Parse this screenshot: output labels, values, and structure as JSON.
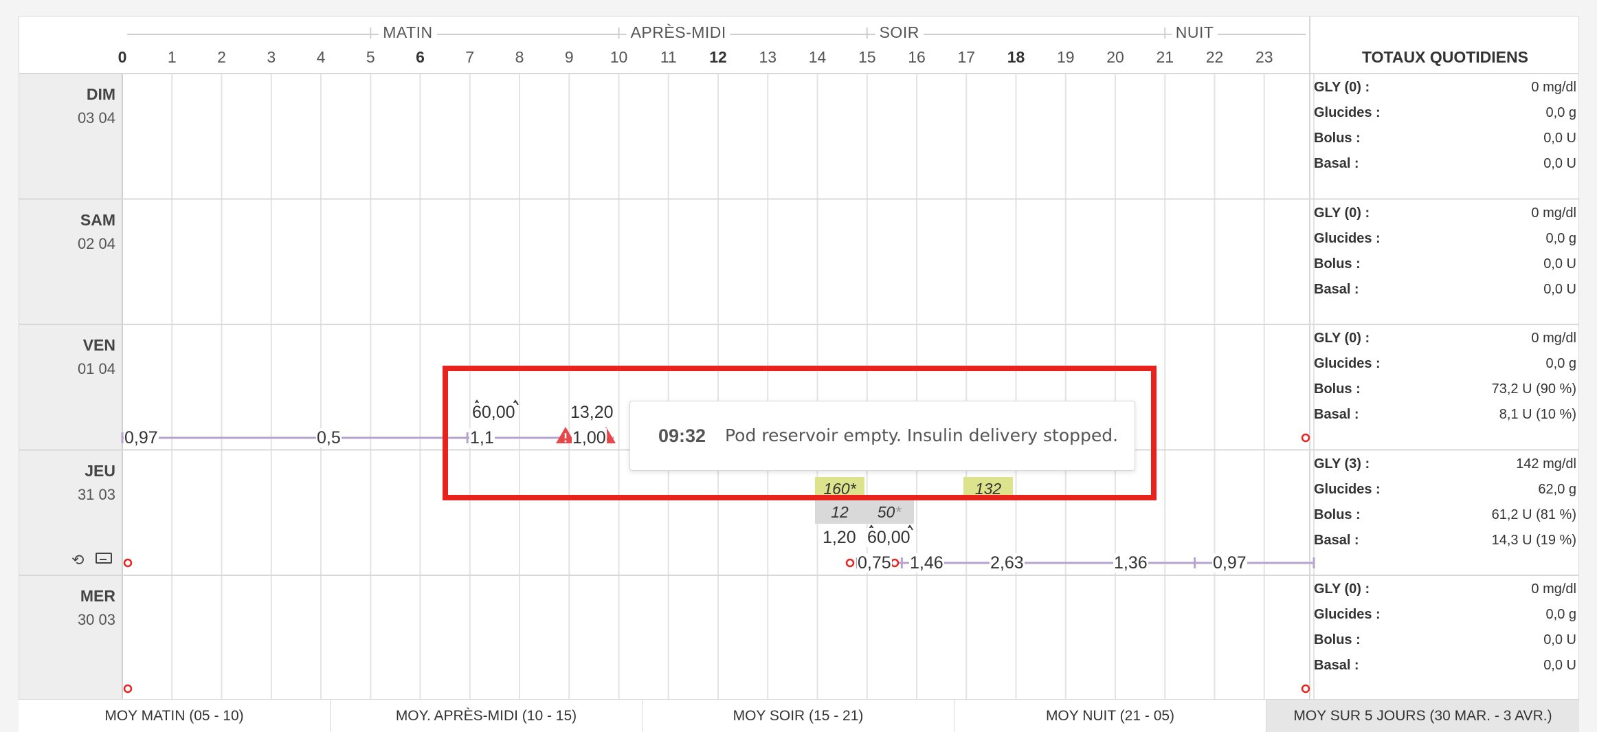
{
  "periods": [
    {
      "label": "MATIN",
      "hour": 5.75
    },
    {
      "label": "APRÈS-MIDI",
      "hour": 11.2
    },
    {
      "label": "SOIR",
      "hour": 15.65
    },
    {
      "label": "NUIT",
      "hour": 21.6
    }
  ],
  "hours": [
    "0",
    "1",
    "2",
    "3",
    "4",
    "5",
    "6",
    "7",
    "8",
    "9",
    "10",
    "11",
    "12",
    "13",
    "14",
    "15",
    "16",
    "17",
    "18",
    "19",
    "20",
    "21",
    "22",
    "23"
  ],
  "bold_hours": [
    "0",
    "6",
    "12",
    "18"
  ],
  "totals_title": "TOTAUX QUOTIDIENS",
  "days": [
    {
      "name": "DIM",
      "date": "03 04",
      "totals": [
        {
          "label": "GLY (0) :",
          "value": "0 mg/dl"
        },
        {
          "label": "Glucides :",
          "value": "0,0 g"
        },
        {
          "label": "Bolus :",
          "value": "0,0 U"
        },
        {
          "label": "Basal :",
          "value": "0,0 U"
        }
      ]
    },
    {
      "name": "SAM",
      "date": "02 04",
      "totals": [
        {
          "label": "GLY (0) :",
          "value": "0 mg/dl"
        },
        {
          "label": "Glucides :",
          "value": "0,0 g"
        },
        {
          "label": "Bolus :",
          "value": "0,0 U"
        },
        {
          "label": "Basal :",
          "value": "0,0 U"
        }
      ]
    },
    {
      "name": "VEN",
      "date": "01 04",
      "totals": [
        {
          "label": "GLY (0) :",
          "value": "0 mg/dl"
        },
        {
          "label": "Glucides :",
          "value": "0,0 g"
        },
        {
          "label": "Bolus :",
          "value": "73,2 U (90 %)"
        },
        {
          "label": "Basal :",
          "value": "8,1 U (10 %)"
        }
      ]
    },
    {
      "name": "JEU",
      "date": "31 03",
      "totals": [
        {
          "label": "GLY (3) :",
          "value": "142 mg/dl"
        },
        {
          "label": "Glucides :",
          "value": "62,0 g"
        },
        {
          "label": "Bolus :",
          "value": "61,2 U (81 %)"
        },
        {
          "label": "Basal :",
          "value": "14,3 U (19 %)"
        }
      ]
    },
    {
      "name": "MER",
      "date": "30 03",
      "totals": [
        {
          "label": "GLY (0) :",
          "value": "0 mg/dl"
        },
        {
          "label": "Glucides :",
          "value": "0,0 g"
        },
        {
          "label": "Bolus :",
          "value": "0,0 U"
        },
        {
          "label": "Basal :",
          "value": "0,0 U"
        }
      ]
    }
  ],
  "ven_basal": [
    "0,97",
    "0,5",
    "1,1",
    "1,00"
  ],
  "ven_bolus": [
    "60,00",
    "13,20"
  ],
  "jeu_glucose": [
    "160",
    "132"
  ],
  "jeu_carbs": [
    "12",
    "50"
  ],
  "jeu_bolus": [
    "1,20",
    "60,00"
  ],
  "jeu_basal": [
    "0,75",
    "1,46",
    "2,63",
    "1,36",
    "0,97"
  ],
  "popup": {
    "time": "09:32",
    "message": "Pod reservoir empty. Insulin delivery stopped."
  },
  "colors": {
    "basal_line": "#b7a3cf",
    "glucose_bg": "#dde28c",
    "carbs_bg": "#d9d9d9",
    "alert": "#e8474a",
    "highlight": "#e8231e"
  },
  "footer_tabs": [
    "MOY MATIN (05 - 10)",
    "MOY. APRÈS-MIDI (10 - 15)",
    "MOY SOIR (15 - 21)",
    "MOY NUIT (21 - 05)",
    "MOY SUR 5 JOURS (30 MAR. - 3 AVR.)"
  ]
}
